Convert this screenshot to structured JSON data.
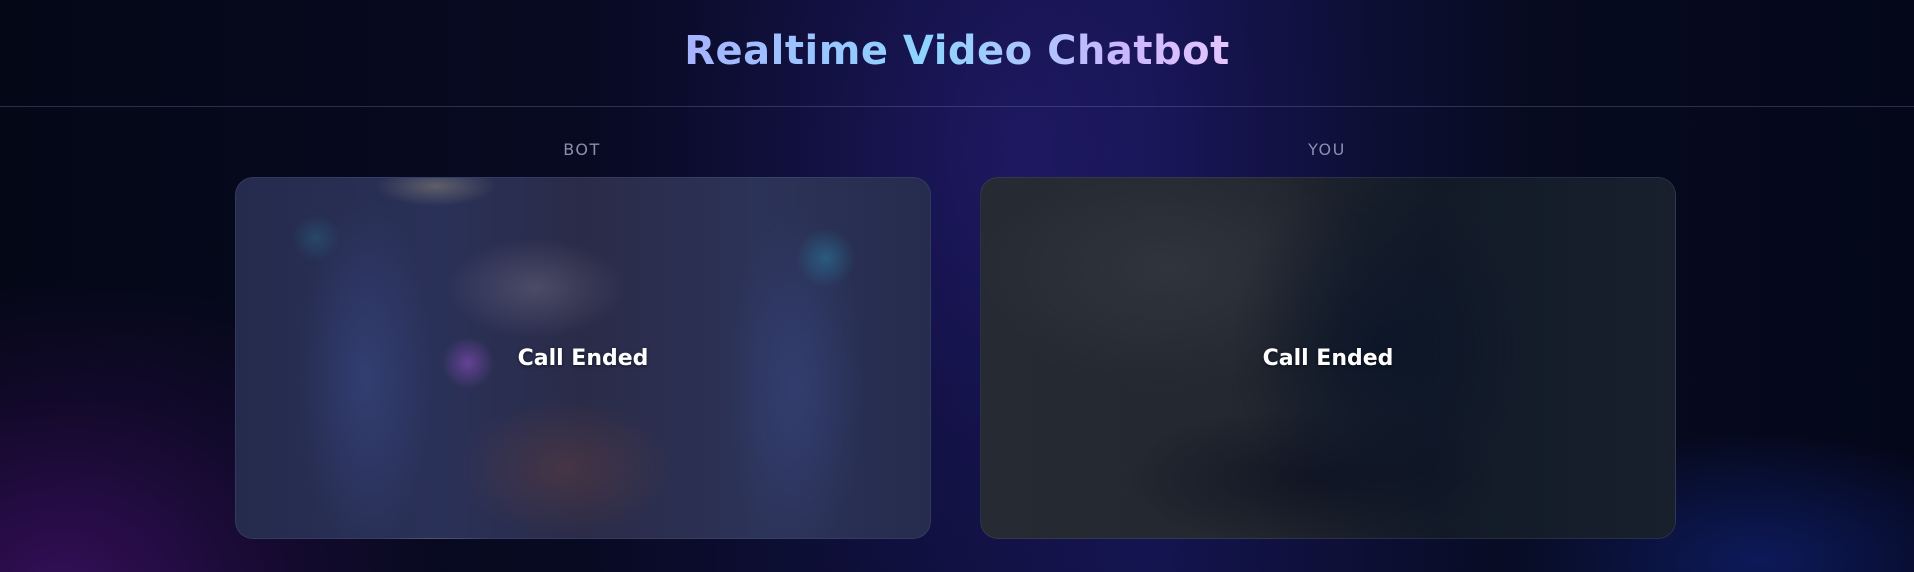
{
  "header": {
    "title": "Realtime Video Chatbot"
  },
  "panels": [
    {
      "label": "BOT",
      "status": "Call Ended"
    },
    {
      "label": "YOU",
      "status": "Call Ended"
    }
  ],
  "colors": {
    "title_gradient": [
      "#a7b3ff",
      "#8ed4ff",
      "#e4c6ff"
    ],
    "background": "#06091c",
    "label": "#8a8fae"
  }
}
